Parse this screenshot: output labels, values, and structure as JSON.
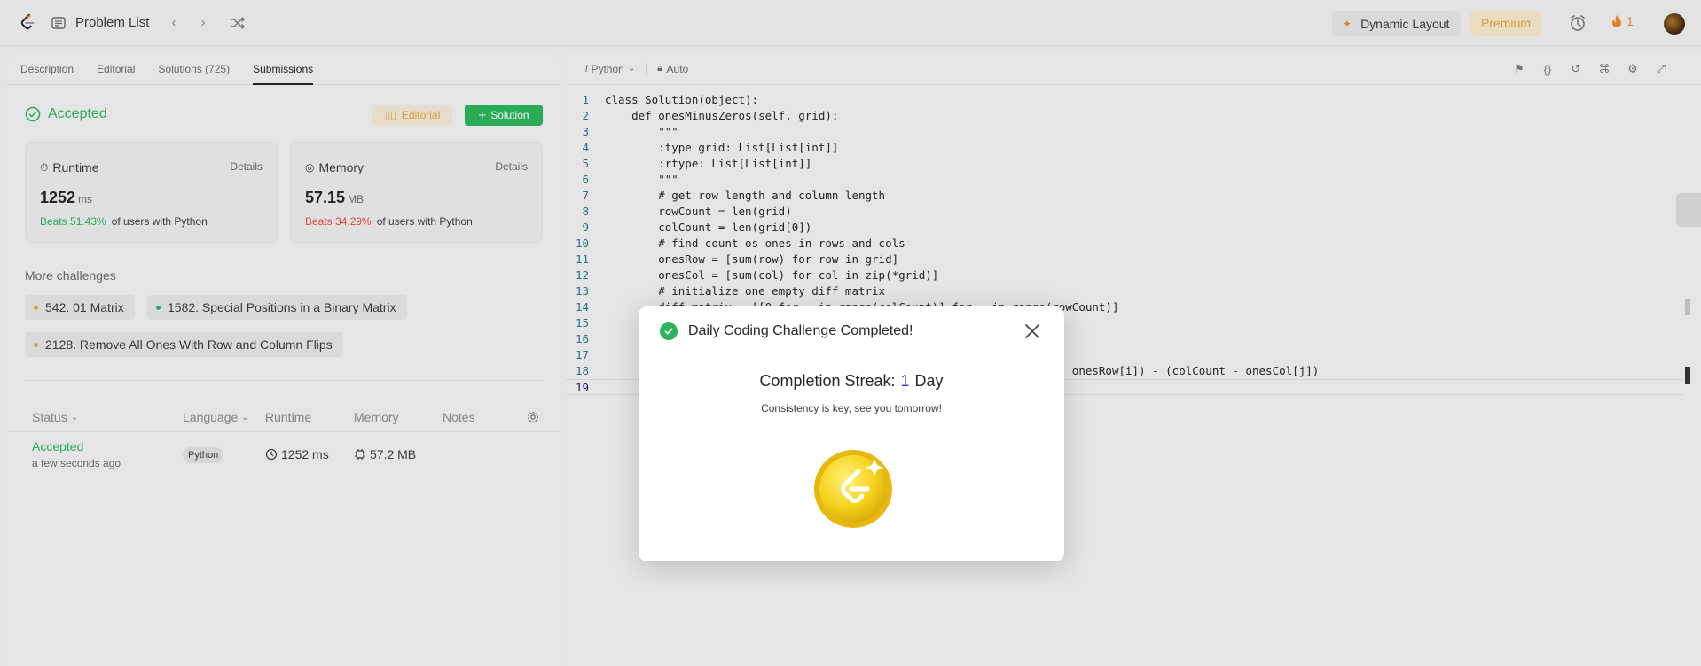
{
  "topnav": {
    "problem_list": "Problem List",
    "dynamic_layout": "Dynamic Layout",
    "premium": "Premium",
    "streak_count": "1"
  },
  "tabs": [
    {
      "label": "Description"
    },
    {
      "label": "Editorial"
    },
    {
      "label": "Solutions (725)"
    },
    {
      "label": "Submissions"
    }
  ],
  "result": {
    "status": "Accepted",
    "editorial_button": "Editorial",
    "solution_button": "Solution",
    "runtime": {
      "label": "Runtime",
      "details": "Details",
      "value": "1252",
      "unit": "ms",
      "beats": "Beats 51.43%",
      "suffix": "of users with Python"
    },
    "memory": {
      "label": "Memory",
      "details": "Details",
      "value": "57.15",
      "unit": "MB",
      "beats": "Beats 34.29%",
      "suffix": "of users with Python"
    }
  },
  "challenges": {
    "title": "More challenges",
    "items": [
      {
        "label": "542. 01 Matrix",
        "dot": "#f0a73a"
      },
      {
        "label": "1582. Special Positions in a Binary Matrix",
        "dot": "#2db55d"
      },
      {
        "label": "2128. Remove All Ones With Row and Column Flips",
        "dot": "#f0a73a"
      }
    ]
  },
  "submissions": {
    "headers": {
      "status": "Status",
      "language": "Language",
      "runtime": "Runtime",
      "memory": "Memory",
      "notes": "Notes"
    },
    "rows": [
      {
        "status": "Accepted",
        "when": "a few seconds ago",
        "language": "Python",
        "runtime": "1252 ms",
        "memory": "57.2 MB"
      }
    ]
  },
  "editor": {
    "language": "Python",
    "auto": "Auto",
    "lines": [
      "class Solution(object):",
      "    def onesMinusZeros(self, grid):",
      "        \"\"\"",
      "        :type grid: List[List[int]]",
      "        :rtype: List[List[int]]",
      "        \"\"\"",
      "        # get row length and column length",
      "        rowCount = len(grid)",
      "        colCount = len(grid[0])",
      "        # find count os ones in rows and cols",
      "        onesRow = [sum(row) for row in grid]",
      "        onesCol = [sum(col) for col in zip(*grid)]",
      "        # initialize one empty diff matrix",
      "        diff_matrix = [[0 for _ in range(colCount)] for _ in range(rowCount)]",
      "",
      "",
      "",
      "                                                            owCount - onesRow[i]) - (colCount - onesCol[j])",
      ""
    ]
  },
  "modal": {
    "title": "Daily Coding Challenge Completed!",
    "streak_label": "Completion Streak:",
    "streak_value": "1",
    "streak_unit": "Day",
    "subtitle": "Consistency is key, see you tomorrow!"
  },
  "colors": {
    "accent_green": "#2db55d",
    "accent_orange": "#f0842b",
    "premium_gold": "#e0a341",
    "danger_red": "#ef4743",
    "streak_blue": "#2f3ed8"
  }
}
